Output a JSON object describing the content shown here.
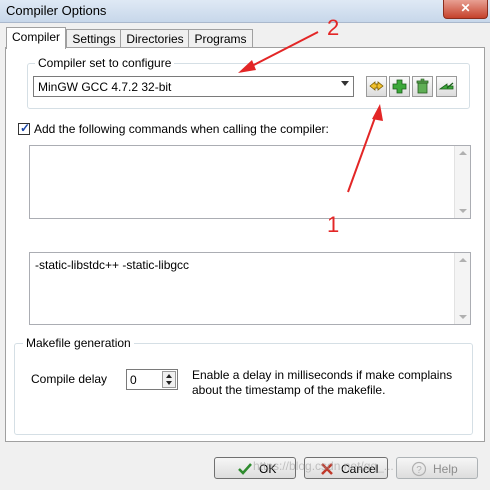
{
  "window": {
    "title": "Compiler Options",
    "close_glyph": "✕"
  },
  "tabs": [
    "Compiler",
    "Settings",
    "Directories",
    "Programs"
  ],
  "compiler_set": {
    "group_label": "Compiler set to configure",
    "selected": "MinGW GCC 4.7.2 32-bit"
  },
  "toolbar_icons": [
    "rename-icon",
    "add-icon",
    "delete-icon",
    "find-icon"
  ],
  "add_commands": {
    "checked": true,
    "label": "Add the following commands when calling the compiler:",
    "compiler_commands": "",
    "linker_commands": "-static-libstdc++ -static-libgcc"
  },
  "makefile": {
    "group_label": "Makefile generation",
    "delay_label": "Compile delay",
    "delay_value": "0",
    "description_line1": "Enable a delay in milliseconds if make complains",
    "description_line2": "about the timestamp of the makefile."
  },
  "buttons": {
    "ok": "OK",
    "cancel": "Cancel",
    "help": "Help"
  },
  "annotations": {
    "label_1": "1",
    "label_2": "2",
    "color": "#e32626"
  },
  "watermark": "https://blog.csdn.net/qq_..."
}
